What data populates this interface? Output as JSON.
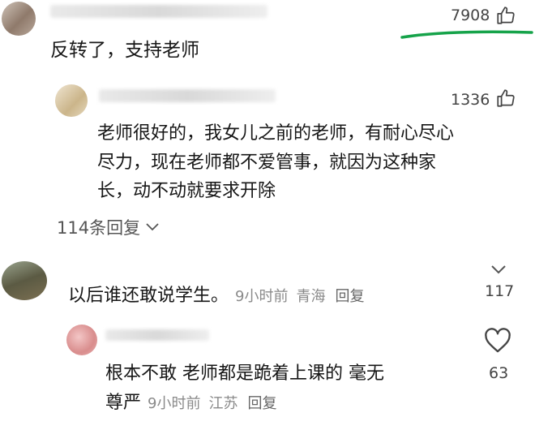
{
  "comment1": {
    "text": "反转了，支持老师",
    "likes": "7908"
  },
  "reply1": {
    "text_line1": "老师很好的，我女儿之前的老师，有耐心尽心",
    "text_line2": "尽力，现在老师都不爱管事，就因为这种家",
    "text_line3": "长，动不动就要求开除",
    "likes": "1336",
    "replies_toggle": "114条回复"
  },
  "comment2": {
    "text": "以后谁还敢说学生。",
    "time": "9小时前",
    "location": "青海",
    "reply_label": "回复",
    "likes": "117"
  },
  "reply2": {
    "text_line1": "根本不敢 老师都是跪着上课的 毫无",
    "text_line2": "尊严",
    "time": "9小时前",
    "location": "江苏",
    "reply_label": "回复",
    "likes": "63"
  },
  "colors": {
    "annotation_underline": "#16a34a",
    "muted": "#8a8a8a"
  }
}
